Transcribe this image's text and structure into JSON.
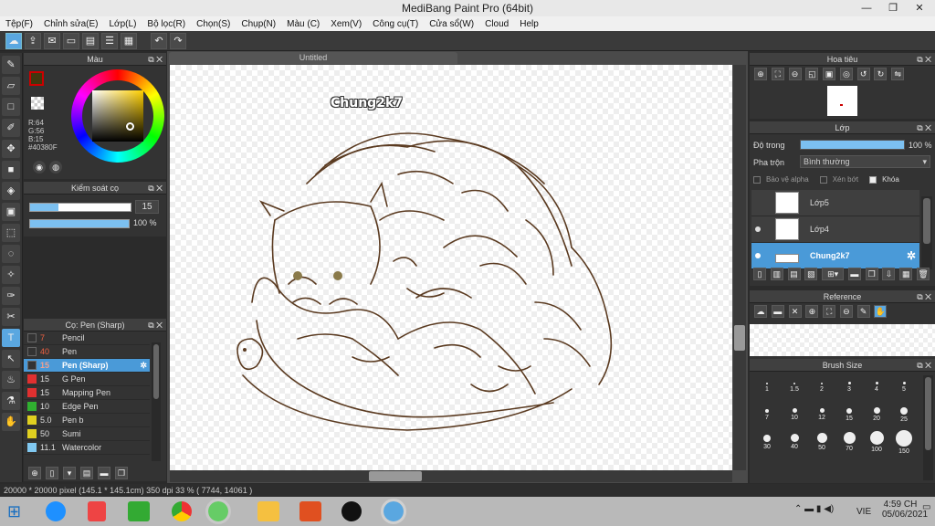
{
  "window": {
    "title": "MediBang Paint Pro (64bit)",
    "min": "—",
    "max": "❐",
    "close": "✕"
  },
  "menu": [
    "Tệp(F)",
    "Chỉnh sửa(E)",
    "Lớp(L)",
    "Bộ lọc(R)",
    "Chọn(S)",
    "Chụp(N)",
    "Màu (C)",
    "Xem(V)",
    "Công cụ(T)",
    "Cửa sổ(W)",
    "Cloud",
    "Help"
  ],
  "color_panel": {
    "title": "Màu",
    "r": "R:64",
    "g": "G:56",
    "b": "B:15",
    "hex": "#40380F",
    "main_color": "#40380F"
  },
  "brush_control": {
    "title": "Kiểm soát cọ",
    "size": "15",
    "opacity": "100 %",
    "opacity_value": 1.0
  },
  "brush_panel": {
    "title": "Cọ: Pen (Sharp)",
    "items": [
      {
        "size": "7",
        "name": "Pencil",
        "color": "#333333"
      },
      {
        "size": "40",
        "name": "Pen",
        "color": "#333333"
      },
      {
        "size": "15",
        "name": "Pen (Sharp)",
        "color": "#333333"
      },
      {
        "size": "15",
        "name": "G Pen",
        "color": "#e03030"
      },
      {
        "size": "15",
        "name": "Mapping Pen",
        "color": "#e03030"
      },
      {
        "size": "10",
        "name": "Edge Pen",
        "color": "#30b030"
      },
      {
        "size": "5.0",
        "name": "Pen b",
        "color": "#e0d020"
      },
      {
        "size": "50",
        "name": "Sumi",
        "color": "#e0d020"
      },
      {
        "size": "11.1",
        "name": "Watercolor",
        "color": "#80c8f0"
      }
    ]
  },
  "document": {
    "tab": "Untitled",
    "signature": "Chung2k7"
  },
  "navigator": {
    "title": "Hoa tiêu"
  },
  "layers": {
    "title": "Lớp",
    "opacity_label": "Độ trong",
    "opacity": "100 %",
    "blend_label": "Pha trộn",
    "blend": "Bình thường",
    "protect_alpha": "Bảo vệ alpha",
    "clip": "Xén bớt",
    "lock": "Khóa",
    "items": [
      {
        "name": "Lớp5"
      },
      {
        "name": "Lớp4"
      },
      {
        "name": "Chung2k7"
      }
    ]
  },
  "reference": {
    "title": "Reference"
  },
  "brush_size": {
    "title": "Brush Size",
    "sizes": [
      "1",
      "1.5",
      "2",
      "3",
      "4",
      "5",
      "7",
      "10",
      "12",
      "15",
      "20",
      "25",
      "30",
      "40",
      "50",
      "70",
      "100",
      "150"
    ]
  },
  "status": {
    "text": "20000 * 20000 pixel   (145.1 * 145.1cm)   350 dpi   33 %   ( 7744, 14061 )"
  },
  "taskbar": {
    "lang": "VIE",
    "time": "4:59 CH",
    "date": "05/06/2021"
  }
}
